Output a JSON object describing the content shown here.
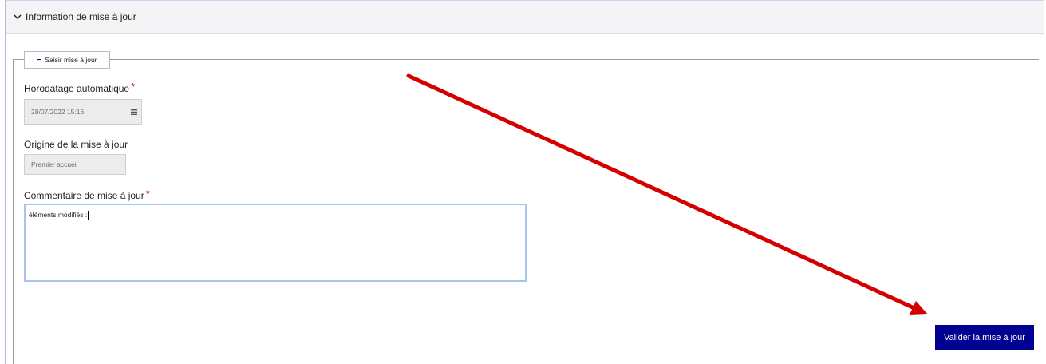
{
  "panel": {
    "title": "Information de mise à jour"
  },
  "section": {
    "toggle_label": "Saisir mise à jour"
  },
  "fields": {
    "timestamp": {
      "label": "Horodatage automatique",
      "required_mark": "*",
      "value": "28/07/2022 15:16",
      "icon": "calendar-icon"
    },
    "origin": {
      "label": "Origine de la mise à jour",
      "value": "Premier accueil"
    },
    "comment": {
      "label": "Commentaire de mise à jour",
      "required_mark": "*",
      "value": "éléments modifiés :"
    }
  },
  "actions": {
    "submit_label": "Valider la mise à jour"
  },
  "colors": {
    "primary": "#000091",
    "required": "#e1000f",
    "annotation_arrow": "#d40000"
  }
}
